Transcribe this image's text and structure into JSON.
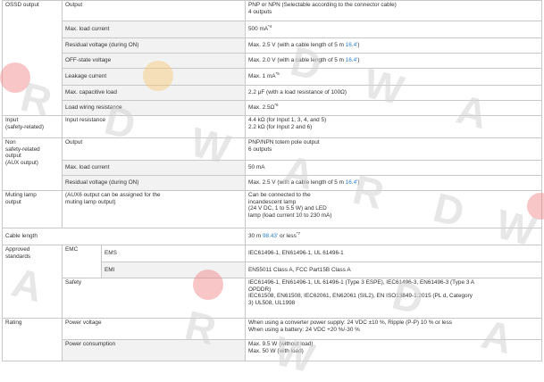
{
  "watermark": {
    "letters": [
      "D",
      "W",
      "A",
      "R",
      "D",
      "W",
      "A",
      "R",
      "D",
      "W",
      "A",
      "R",
      "D",
      "W",
      "A"
    ]
  },
  "colors": {
    "link": "#2a7fd4",
    "border": "#c8c8c8",
    "label_bg": "#f2f2f2",
    "watermark_dot_red": "#f08080",
    "watermark_dot_yellow": "#f7c873"
  },
  "ossd": {
    "category": "OSSD output",
    "rows": [
      {
        "label": "Output",
        "value_line1": "PNP or NPN (Selectable according to the connector cable)",
        "value_line2": "4 outputs"
      },
      {
        "label": "Max. load current",
        "value": "500 mA",
        "sup": "*4"
      },
      {
        "label": "Residual voltage (during ON)",
        "value": "Max. 2.5 V (with a cable length of 5 m ",
        "link": "16.4'",
        "value_end": ")"
      },
      {
        "label": "OFF-state voltage",
        "value": "Max. 2.0 V (with a cable length of 5 m ",
        "link": "16.4'",
        "value_end": ")"
      },
      {
        "label": "Leakage current",
        "value": "Max. 1 mA",
        "sup": "*5"
      },
      {
        "label": "Max. capacitive load",
        "value": "2.2 μF (with a load resistance of 100Ω)"
      },
      {
        "label": "Load wiring resistance",
        "value": "Max. 2.5Ω",
        "sup": "*6"
      }
    ]
  },
  "input": {
    "category_line1": "Input",
    "category_line2": "(safety-related)",
    "label": "Input resistance",
    "value_line1": "4.4 kΩ (for Input 1, 3, 4, and 5)",
    "value_line2": "2.2 kΩ (for Input 2 and 6)"
  },
  "aux": {
    "category_line1": "Non",
    "category_line2": "safety-related",
    "category_line3": "output",
    "category_line4": "(AUX output)",
    "rows": [
      {
        "label": "Output",
        "value_line1": "PNP/NPN totem pole output",
        "value_line2": "6 outputs"
      },
      {
        "label": "Max. load current",
        "value": "50 mA"
      },
      {
        "label": "Residual voltage (during ON)",
        "value": "Max. 2.5 V (with a cable length of 5 m ",
        "link": "16.4'",
        "value_end": ")"
      }
    ]
  },
  "muting": {
    "category_line1": "Muting lamp",
    "category_line2": "output",
    "label_line1": "(AUX6 output can be assigned for the",
    "label_line2": "muting lamp output)",
    "value_line1": "Can be connected to the",
    "value_line2": "incandescent lamp",
    "value_line3": "(24 V DC, 1 to 5.5 W) and LED",
    "value_line4": "lamp (load current 10 to 230 mA)"
  },
  "cable": {
    "category": "Cable length",
    "value": "30 m ",
    "link": "98.43'",
    "value_end": " or less",
    "sup": "*7"
  },
  "approved": {
    "category_line1": "Approved",
    "category_line2": "standards",
    "emc": "EMC",
    "ems_label": "EMS",
    "ems_value": "IEC61496-1, EN61496-1, UL 61496-1",
    "emi_label": "EMI",
    "emi_value": "EN55011 Class A, FCC Part15B Class A",
    "safety_label": "Safety",
    "safety_line1": "IEC61496-1, EN61496-1, UL 61496-1 (Type 3 ESPE), IEC61496-3, EN61496-3 (Type 3 A",
    "safety_line2": "OPDDR)",
    "safety_line3": "IEC61508, EN61508, IEC62061, EN62061 (SIL2), EN ISO13849-1:2015 (PL d, Category",
    "safety_line4": "3) UL508, UL1998"
  },
  "rating": {
    "category": "Rating",
    "power_voltage_label": "Power voltage",
    "power_voltage_line1": "When using a converter power supply: 24 VDC ±10 %, Ripple (P-P) 10 % or less",
    "power_voltage_line2": "When using a battery: 24 VDC +20 %/-30 %",
    "power_consumption_label": "Power consumption",
    "power_consumption_line1": "Max. 9.5 W (without load)",
    "power_consumption_line2": "Max. 50 W (with load)"
  }
}
